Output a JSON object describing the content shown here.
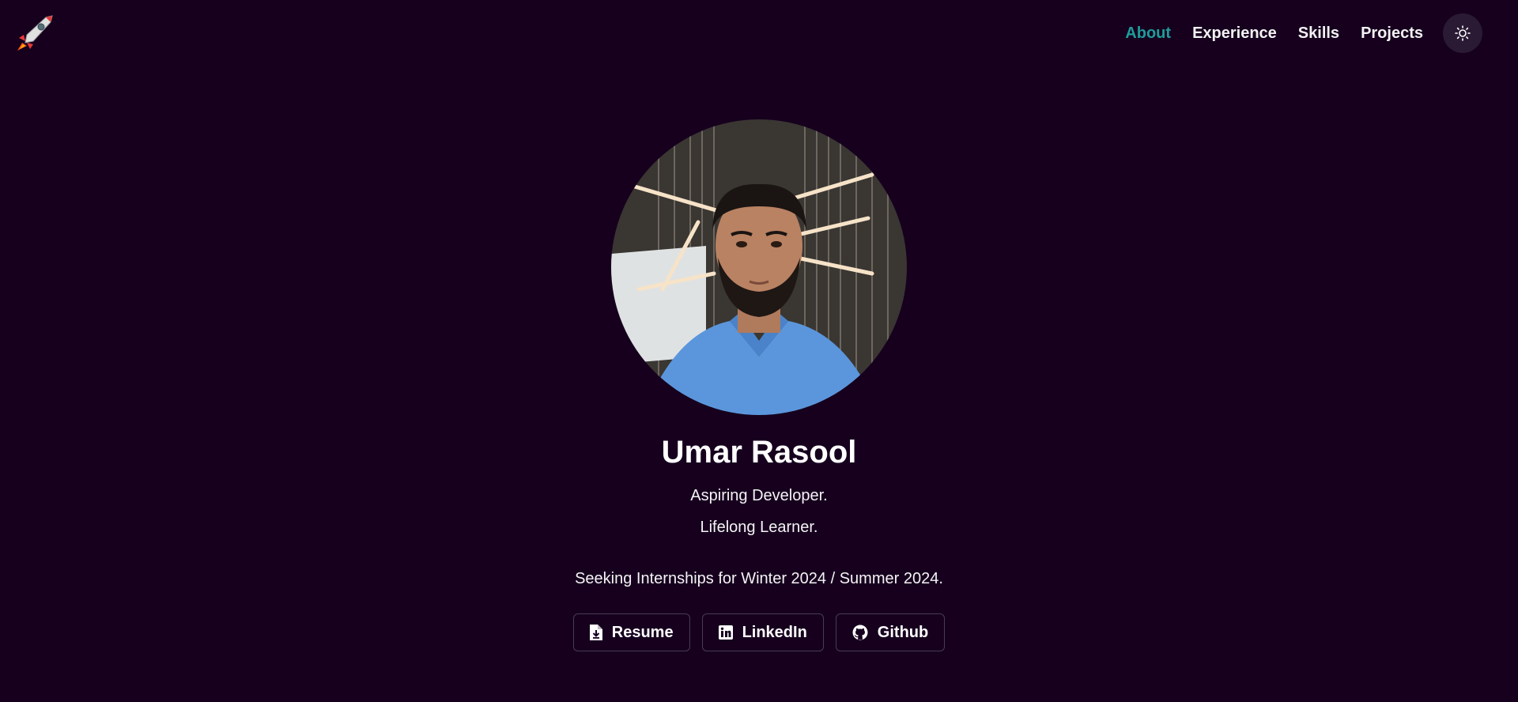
{
  "header": {
    "logo_icon": "rocket-icon",
    "nav": [
      {
        "label": "About",
        "active": true
      },
      {
        "label": "Experience",
        "active": false
      },
      {
        "label": "Skills",
        "active": false
      },
      {
        "label": "Projects",
        "active": false
      }
    ],
    "theme_toggle_icon": "sun-icon"
  },
  "hero": {
    "name": "Umar Rasool",
    "tagline_1": "Aspiring Developer.",
    "tagline_2": "Lifelong Learner.",
    "seeking": "Seeking Internships for Winter 2024 / Summer 2024.",
    "buttons": [
      {
        "label": "Resume",
        "icon": "file-download-icon"
      },
      {
        "label": "LinkedIn",
        "icon": "linkedin-icon"
      },
      {
        "label": "Github",
        "icon": "github-icon"
      }
    ]
  },
  "colors": {
    "background": "#16001e",
    "accent": "#1f9c9a",
    "text": "#ffffff"
  }
}
